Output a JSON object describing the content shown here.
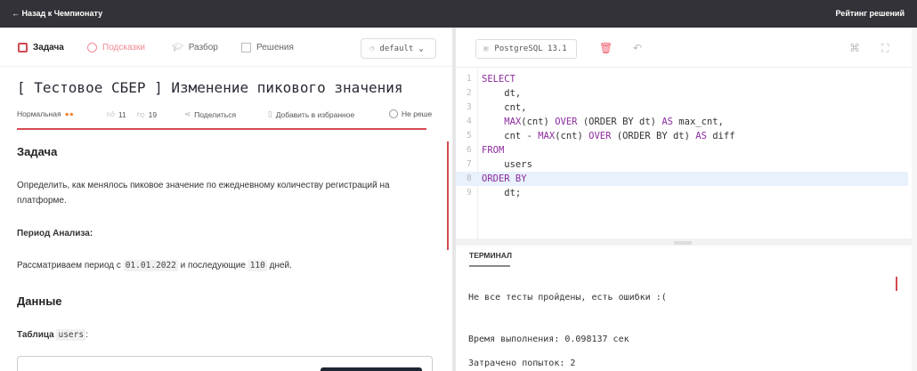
{
  "topbar": {
    "back": "← Назад к Чемпионату",
    "rating": "Рейтинг решений"
  },
  "tabs": [
    {
      "label": "Задача",
      "icon": "document-icon"
    },
    {
      "label": "Подсказки",
      "icon": "info-icon"
    },
    {
      "label": "Разбор",
      "icon": "graduation-cap-icon"
    },
    {
      "label": "Решения",
      "icon": "checklist-icon"
    }
  ],
  "theme": {
    "value": "default"
  },
  "task": {
    "title": "[ Тестовое СБЕР ] Изменение пикового значения",
    "difficulty": "Нормальная",
    "likes": "11",
    "dislikes": "19",
    "share": "Поделиться",
    "favorite": "Добавить в избранное",
    "status": "Не реше"
  },
  "content": {
    "h_task": "Задача",
    "desc": "Определить, как менялось пиковое значение по ежедневному количеству регистраций на платформе.",
    "period_label": "Период Анализа:",
    "period_pre": "Рассматриваем период с ",
    "period_date": "01.01.2022",
    "period_mid": " и последующие ",
    "period_days": "110",
    "period_post": " дней.",
    "h_data": "Данные",
    "table_pre": "Таблица ",
    "table_name": "users",
    "table_post": ":"
  },
  "editor": {
    "engine": "PostgreSQL 13.1",
    "lines": [
      [
        [
          "kw",
          "SELECT"
        ]
      ],
      [
        [
          "",
          "    dt,"
        ]
      ],
      [
        [
          "",
          "    cnt,"
        ]
      ],
      [
        [
          "",
          "    "
        ],
        [
          "kw",
          "MAX"
        ],
        [
          "",
          "(cnt) "
        ],
        [
          "kw",
          "OVER"
        ],
        [
          "",
          " (ORDER BY dt) "
        ],
        [
          "kw",
          "AS"
        ],
        [
          "",
          " max_cnt,"
        ]
      ],
      [
        [
          "",
          "    cnt - "
        ],
        [
          "kw",
          "MAX"
        ],
        [
          "",
          "(cnt) "
        ],
        [
          "kw",
          "OVER"
        ],
        [
          "",
          " (ORDER BY dt) "
        ],
        [
          "kw",
          "AS"
        ],
        [
          "",
          " diff"
        ]
      ],
      [
        [
          "kw",
          "FROM"
        ]
      ],
      [
        [
          "",
          "    users"
        ]
      ],
      [
        [
          "kw",
          "ORDER BY"
        ]
      ],
      [
        [
          "",
          "    dt;"
        ]
      ]
    ]
  },
  "terminal": {
    "tab": "ТЕРМИНАЛ",
    "msg": "Не все тесты пройдены, есть ошибки :(",
    "time": "Время выполнения: 0.098137 сек",
    "attempts": "Затрачено попыток: 2"
  }
}
